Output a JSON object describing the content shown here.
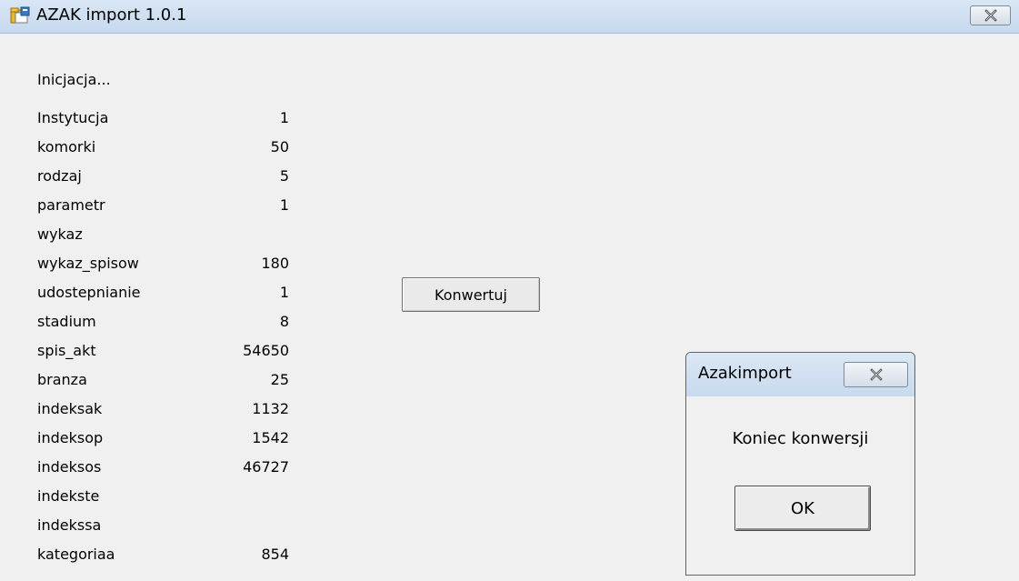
{
  "window": {
    "title": "AZAK import 1.0.1"
  },
  "status_text": "Inicjacja...",
  "rows": [
    {
      "label": "Instytucja",
      "value": "1"
    },
    {
      "label": "komorki",
      "value": "50"
    },
    {
      "label": "rodzaj",
      "value": "5"
    },
    {
      "label": "parametr",
      "value": "1"
    },
    {
      "label": "wykaz",
      "value": ""
    },
    {
      "label": "wykaz_spisow",
      "value": "180"
    },
    {
      "label": "udostepnianie",
      "value": "1"
    },
    {
      "label": "stadium",
      "value": "8"
    },
    {
      "label": "spis_akt",
      "value": "54650"
    },
    {
      "label": "branza",
      "value": "25"
    },
    {
      "label": "indeksak",
      "value": "1132"
    },
    {
      "label": "indeksop",
      "value": "1542"
    },
    {
      "label": "indeksos",
      "value": "46727"
    },
    {
      "label": "indekste",
      "value": ""
    },
    {
      "label": "indekssa",
      "value": ""
    },
    {
      "label": "kategoriaa",
      "value": "854"
    }
  ],
  "convert_button": "Konwertuj",
  "dialog": {
    "title": "Azakimport",
    "message": "Koniec konwersji",
    "ok_label": "OK"
  },
  "icons": {
    "app": "app-folder-icon",
    "close": "close-icon"
  }
}
